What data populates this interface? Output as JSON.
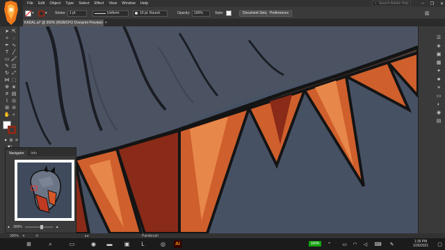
{
  "menu": {
    "items": [
      "File",
      "Edit",
      "Object",
      "Type",
      "Select",
      "Effect",
      "View",
      "Window",
      "Help"
    ],
    "search_placeholder": "Search Adobe Help"
  },
  "controlbar": {
    "stroke_label": "Stroke:",
    "stroke_value": "1 pt",
    "profile_value": "Uniform",
    "brush_value": "10 pt. Round",
    "opacity_label": "Opacity:",
    "opacity_value": "100%",
    "style_label": "Style:",
    "doc_setup": "Document Setup",
    "preferences": "Preferences"
  },
  "document": {
    "tab_title": "KADAL.ai* @ 300% (RGB/CPU Overprint Preview)"
  },
  "navigator": {
    "tab_navigator": "Navigator",
    "tab_info": "Info",
    "zoom": "300%"
  },
  "statusbar": {
    "zoom": "300%",
    "tool": "Paintbrush"
  },
  "taskbar": {
    "battery": "100%",
    "time": "1:39 PM",
    "date": "1/26/2021"
  },
  "colors": {
    "canvas_bg": "#465164",
    "dragon_body": "#4b5363",
    "spike_orange": "#cf5f2c",
    "spike_dark": "#8a2a18",
    "ai_brand": "#ff9a00",
    "battery": "#13a10e"
  }
}
